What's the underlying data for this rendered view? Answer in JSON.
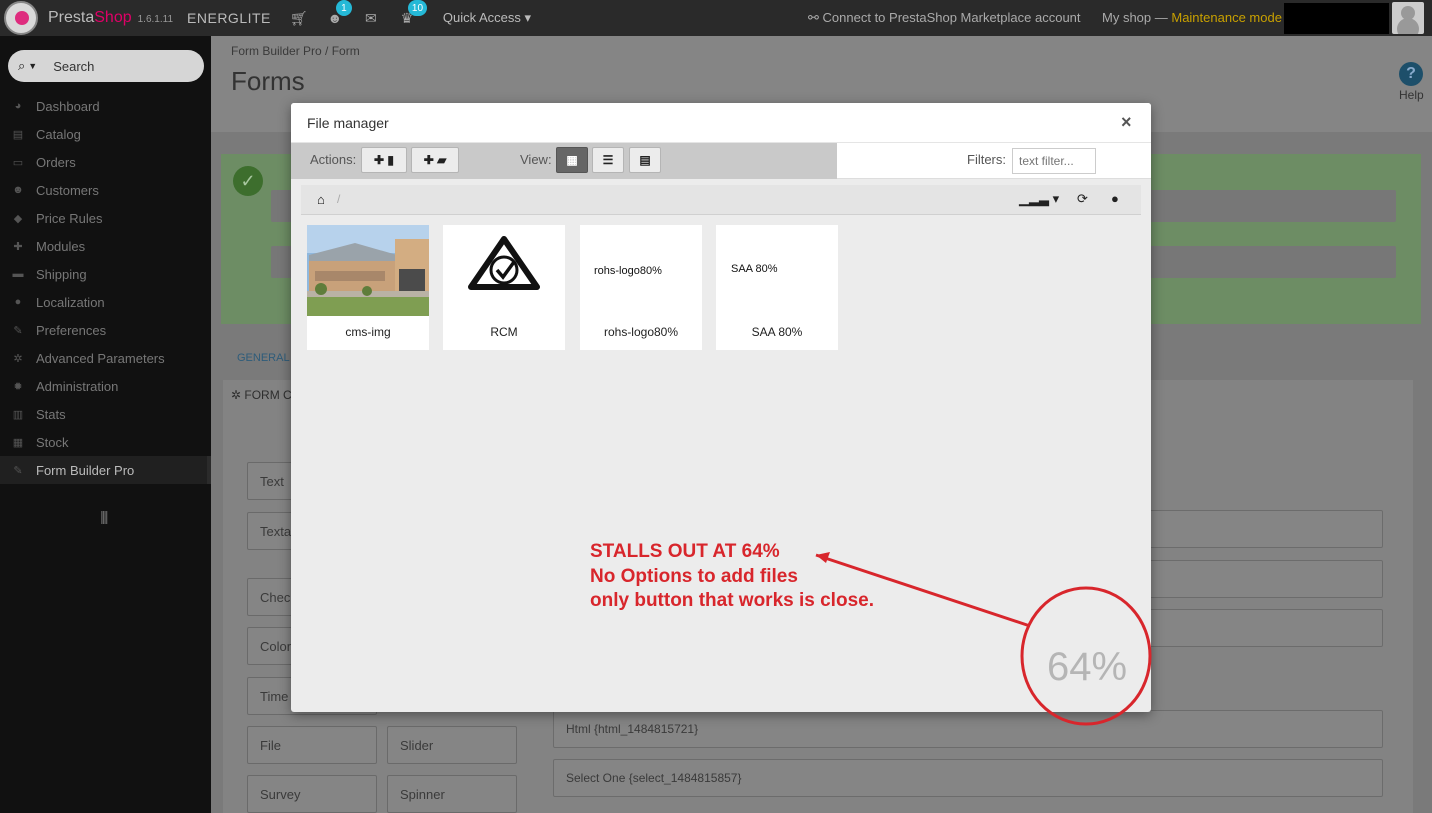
{
  "header": {
    "brand_presta": "Presta",
    "brand_shop": "Shop",
    "version": "1.6.1.11",
    "shop_name": "ENERGLITE",
    "customers_badge": "1",
    "trophy_badge": "10",
    "quick_access": "Quick Access",
    "connect": "Connect to PrestaShop Marketplace account",
    "my_shop": "My shop — ",
    "maintenance": "Maintenance mode"
  },
  "sidebar": {
    "search_placeholder": "Search",
    "items": [
      {
        "label": "Dashboard",
        "icon": "dashboard-icon",
        "glyph": "◕"
      },
      {
        "label": "Catalog",
        "icon": "book-icon",
        "glyph": "▤"
      },
      {
        "label": "Orders",
        "icon": "credit-card-icon",
        "glyph": "▭"
      },
      {
        "label": "Customers",
        "icon": "users-icon",
        "glyph": "☻"
      },
      {
        "label": "Price Rules",
        "icon": "tags-icon",
        "glyph": "◆"
      },
      {
        "label": "Modules",
        "icon": "puzzle-icon",
        "glyph": "✚"
      },
      {
        "label": "Shipping",
        "icon": "truck-icon",
        "glyph": "▬"
      },
      {
        "label": "Localization",
        "icon": "globe-icon",
        "glyph": "●"
      },
      {
        "label": "Preferences",
        "icon": "wrench-icon",
        "glyph": "✎"
      },
      {
        "label": "Advanced Parameters",
        "icon": "cogs-icon",
        "glyph": "✲"
      },
      {
        "label": "Administration",
        "icon": "cog-icon",
        "glyph": "✹"
      },
      {
        "label": "Stats",
        "icon": "bar-chart-icon",
        "glyph": "▥"
      },
      {
        "label": "Stock",
        "icon": "archive-icon",
        "glyph": "▦"
      },
      {
        "label": "Form Builder Pro",
        "icon": "edit-icon",
        "glyph": "✎"
      }
    ],
    "collapse": "||||"
  },
  "main": {
    "breadcrumb": "Form Builder Pro  /  Form",
    "title": "Forms",
    "help": "Help",
    "tab_general": "GENERAL",
    "panel_head": "FORM C",
    "element_buttons": [
      "Text",
      "Textar",
      "Check",
      "Color",
      "Time",
      "File",
      "Slider",
      "Survey",
      "Spinner"
    ],
    "field_rows": [
      "Html {html_1484815721}",
      "Select One {select_1484815857}"
    ]
  },
  "modal": {
    "title": "File manager",
    "close": "×",
    "actions_label": "Actions:",
    "view_label": "View:",
    "filters_label": "Filters:",
    "filter_placeholder": "text filter...",
    "path_sep": "/",
    "files": [
      {
        "name": "cms-img",
        "kind": "image"
      },
      {
        "name": "RCM",
        "kind": "logo"
      },
      {
        "name": "rohs-logo80%",
        "kind": "broken",
        "alt": "rohs-logo80%"
      },
      {
        "name": "SAA 80%",
        "kind": "broken",
        "alt": "SAA 80%"
      }
    ],
    "progress": "64%"
  },
  "annotation": {
    "line1": "STALLS OUT AT 64%",
    "line2": "No Options to add files",
    "line3": "only button that works is close."
  },
  "colors": {
    "annotation": "#d8262c",
    "accent": "#25b9d7",
    "maintenance": "#c8a000"
  }
}
